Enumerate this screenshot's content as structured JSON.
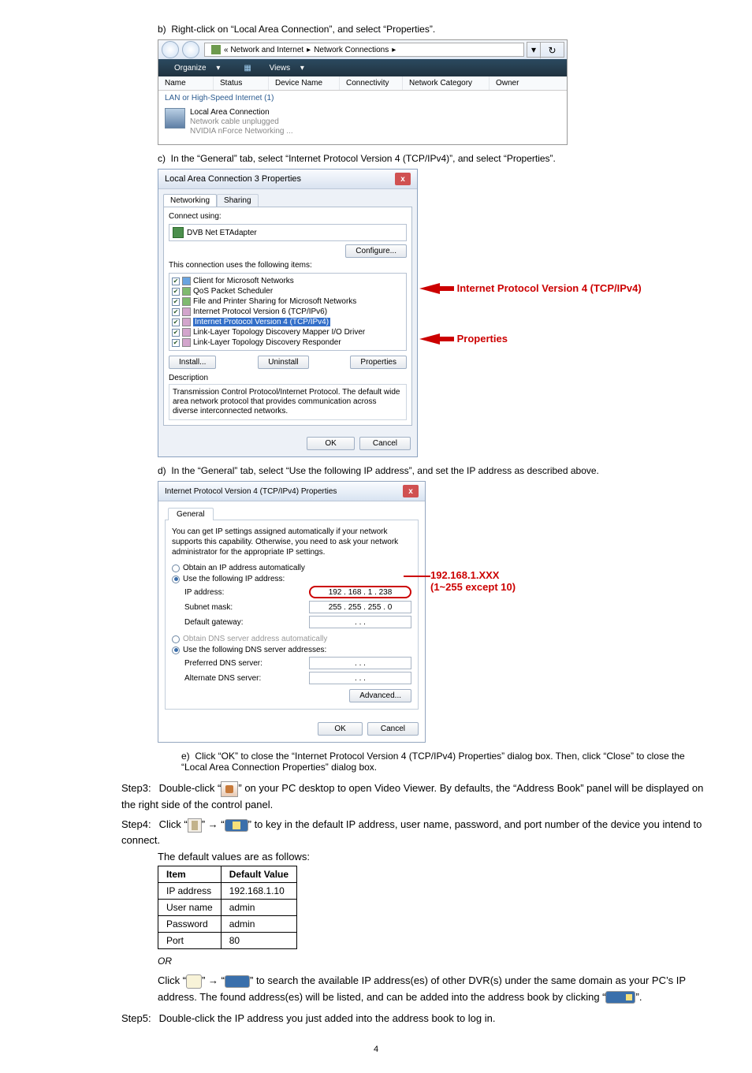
{
  "steps": {
    "b": "Right-click on “Local Area Connection”, and select “Properties”.",
    "c": "In the “General” tab, select “Internet Protocol Version 4 (TCP/IPv4)”, and select “Properties”.",
    "d": "In the “General” tab, select “Use the following IP address”, and set the IP address as described above.",
    "e": "Click “OK” to close the “Internet Protocol Version 4 (TCP/IPv4) Properties” dialog box. Then, click “Close” to close the “Local Area Connection Properties” dialog box."
  },
  "explorer": {
    "breadcrumb_prefix": "« Network and Internet",
    "breadcrumb_current": "Network Connections",
    "toolbar": {
      "organize": "Organize",
      "views": "Views"
    },
    "headers": {
      "name": "Name",
      "status": "Status",
      "device": "Device Name",
      "conn": "Connectivity",
      "cat": "Network Category",
      "owner": "Owner"
    },
    "group": "LAN or High-Speed Internet (1)",
    "conn_name": "Local Area Connection",
    "conn_status": "Network cable unplugged",
    "conn_device": "NVIDIA nForce Networking ..."
  },
  "lac_dialog": {
    "title": "Local Area Connection 3 Properties",
    "tabs": {
      "net": "Networking",
      "share": "Sharing"
    },
    "connect_label": "Connect using:",
    "adapter": "DVB Net ETAdapter",
    "configure": "Configure...",
    "list_label": "This connection uses the following items:",
    "items": [
      "Client for Microsoft Networks",
      "QoS Packet Scheduler",
      "File and Printer Sharing for Microsoft Networks",
      "Internet Protocol Version 6 (TCP/IPv6)",
      "Internet Protocol Version 4 (TCP/IPv4)",
      "Link-Layer Topology Discovery Mapper I/O Driver",
      "Link-Layer Topology Discovery Responder"
    ],
    "install": "Install...",
    "uninstall": "Uninstall",
    "properties": "Properties",
    "desc_label": "Description",
    "desc_text": "Transmission Control Protocol/Internet Protocol. The default wide area network protocol that provides communication across diverse interconnected networks.",
    "ok": "OK",
    "cancel": "Cancel",
    "callout_ipv4": "Internet Protocol Version 4 (TCP/IPv4)",
    "callout_props": "Properties"
  },
  "ip_dialog": {
    "title": "Internet Protocol Version 4 (TCP/IPv4) Properties",
    "tab": "General",
    "note": "You can get IP settings assigned automatically if your network supports this capability. Otherwise, you need to ask your network administrator for the appropriate IP settings.",
    "r_auto": "Obtain an IP address automatically",
    "r_manual": "Use the following IP address:",
    "ip_label": "IP address:",
    "ip_val": "192 . 168 .   1  . 238",
    "mask_label": "Subnet mask:",
    "mask_val": "255 . 255 . 255 .   0",
    "gw_label": "Default gateway:",
    "gw_val": ".       .       .",
    "dns_auto": "Obtain DNS server address automatically",
    "dns_manual": "Use the following DNS server addresses:",
    "pref_label": "Preferred DNS server:",
    "pref_val": ".       .       .",
    "alt_label": "Alternate DNS server:",
    "alt_val": ".       .       .",
    "advanced": "Advanced...",
    "ok": "OK",
    "cancel": "Cancel",
    "callout_line1": "192.168.1.XXX",
    "callout_line2": "(1~255 except 10)"
  },
  "step3": {
    "label": "Step3:",
    "t1": "Double-click “",
    "t2": "” on your PC desktop to open Video Viewer. By defaults, the “Address Book” panel will be displayed on the right side of the control panel."
  },
  "step4": {
    "label": "Step4:",
    "t1": "Click “",
    "t2": "” → “",
    "t3": "” to key in the default IP address, user name, password, and port number of the device you intend to connect.",
    "tableintro": "The default values are as follows:",
    "table": {
      "h1": "Item",
      "h2": "Default Value",
      "rows": [
        {
          "k": "IP address",
          "v": "192.168.1.10"
        },
        {
          "k": "User name",
          "v": "admin"
        },
        {
          "k": "Password",
          "v": "admin"
        },
        {
          "k": "Port",
          "v": "80"
        }
      ]
    },
    "or": "OR",
    "alt1": "Click “",
    "alt2": "” → “",
    "alt3": "” to search the available IP address(es) of other DVR(s) under the same domain as your PC’s IP address. The found address(es) will be listed, and can be added into the address book by clicking “",
    "alt4": "”."
  },
  "step5": {
    "label": "Step5:",
    "text": "Double-click the IP address you just added into the address book to log in."
  },
  "page": "4"
}
